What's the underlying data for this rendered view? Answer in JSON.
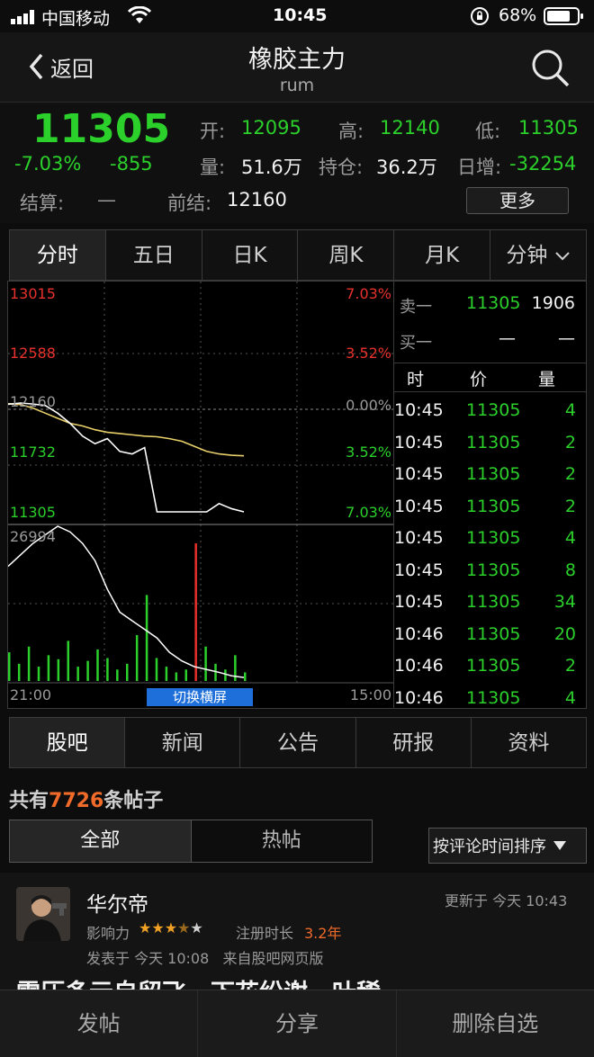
{
  "status_bar": {
    "carrier": "中国移动",
    "time": "10:45",
    "battery": "68%"
  },
  "nav": {
    "back_label": "返回",
    "title": "橡胶主力",
    "subtitle": "rum"
  },
  "quote": {
    "price": "11305",
    "change_pct": "-7.03%",
    "change": "-855",
    "open_label": "开:",
    "open": "12095",
    "high_label": "高:",
    "high": "12140",
    "low_label": "低:",
    "low": "11305",
    "volume_label": "量:",
    "volume": "51.6万",
    "oi_label": "持仓:",
    "oi": "36.2万",
    "day_inc_label": "日增:",
    "day_inc": "-32254",
    "settle_label": "结算:",
    "settle": "—",
    "prev_settle_label": "前结:",
    "prev_settle": "12160",
    "more_label": "更多"
  },
  "chart_tabs": [
    "分时",
    "五日",
    "日K",
    "周K",
    "月K",
    "分钟"
  ],
  "chart_data": {
    "type": "line",
    "price_axis_left": [
      "13015",
      "12588",
      "12160",
      "11732",
      "11305"
    ],
    "price_axis_right": [
      "7.03%",
      "3.52%",
      "0.00%",
      "3.52%",
      "7.03%"
    ],
    "volume_axis_max": "26994",
    "time_start": "21:00",
    "time_end": "15:00",
    "ylim": [
      11305,
      13015
    ],
    "series": [
      {
        "values": [
          12150,
          12160,
          12152,
          12140,
          12080,
          12000,
          11900,
          11840,
          11880,
          11780,
          11760,
          11810,
          11305,
          11305,
          11305,
          11305,
          11305,
          11370,
          11330,
          11305
        ]
      },
      {
        "values": [
          12155,
          12148,
          12120,
          12080,
          12040,
          12000,
          11980,
          11950,
          11930,
          11920,
          11910,
          11900,
          11895,
          11880,
          11860,
          11820,
          11780,
          11760,
          11750,
          11745
        ]
      }
    ],
    "volume_line": [
      20000,
      22000,
      24000,
      25500,
      26994,
      26000,
      24000,
      21000,
      16000,
      12000,
      10500,
      9000,
      7500,
      5000,
      3500,
      2500,
      2000,
      1500,
      900,
      600
    ],
    "volume_bars": [
      5000,
      3000,
      6000,
      2500,
      4500,
      3800,
      7000,
      2500,
      3500,
      5500,
      4000,
      2000,
      3000,
      8000,
      15000,
      4000,
      2500,
      1500,
      2000,
      24000,
      6000,
      3000,
      2000,
      4500,
      1500
    ],
    "legend_button": "切换横屏"
  },
  "order_book": {
    "sell_label": "卖一",
    "sell_price": "11305",
    "sell_qty": "1906",
    "buy_label": "买一",
    "buy_price": "—",
    "buy_qty": "—"
  },
  "trade_list": {
    "headers": [
      "时",
      "价",
      "量"
    ],
    "rows": [
      {
        "time": "10:45",
        "price": "11305",
        "qty": "4"
      },
      {
        "time": "10:45",
        "price": "11305",
        "qty": "2"
      },
      {
        "time": "10:45",
        "price": "11305",
        "qty": "2"
      },
      {
        "time": "10:45",
        "price": "11305",
        "qty": "2"
      },
      {
        "time": "10:45",
        "price": "11305",
        "qty": "4"
      },
      {
        "time": "10:45",
        "price": "11305",
        "qty": "8"
      },
      {
        "time": "10:45",
        "price": "11305",
        "qty": "34"
      },
      {
        "time": "10:46",
        "price": "11305",
        "qty": "20"
      },
      {
        "time": "10:46",
        "price": "11305",
        "qty": "2"
      },
      {
        "time": "10:46",
        "price": "11305",
        "qty": "4"
      }
    ]
  },
  "info_tabs": [
    "股吧",
    "新闻",
    "公告",
    "研报",
    "资料"
  ],
  "posts": {
    "count_prefix": "共有",
    "count": "7726",
    "count_suffix": "条帖子",
    "filter_tabs": [
      "全部",
      "热帖"
    ],
    "sort_label": "按评论时间排序",
    "item": {
      "author": "华尔帝",
      "updated": "更新于 今天 10:43",
      "influence_label": "影响力",
      "rating": 3.5,
      "reg_label": "注册时长",
      "reg_value": "3.2年",
      "posted": "发表于 今天 10:08   来自股吧网页版",
      "title": "雷压多元自留飞，下花纷谢，叶稀"
    }
  },
  "bottom_bar": [
    "发帖",
    "分享",
    "删除自选"
  ]
}
